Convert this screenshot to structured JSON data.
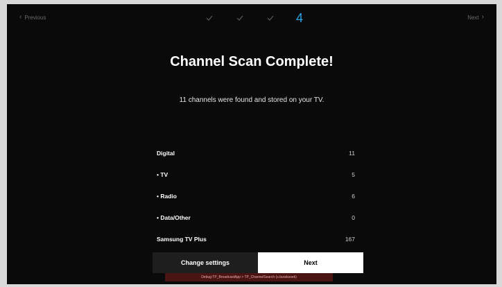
{
  "header": {
    "previous_label": "Previous",
    "next_label": "Next",
    "current_step": "4",
    "completed_steps": 3,
    "step_color": "#2aa6e6"
  },
  "main": {
    "title": "Channel Scan Complete!",
    "subtitle": "11 channels were found and stored on your TV.",
    "results": [
      {
        "label": "Digital",
        "value": "11"
      },
      {
        "label": "• TV",
        "value": "5"
      },
      {
        "label": "• Radio",
        "value": "6"
      },
      {
        "label": "• Data/Other",
        "value": "0"
      },
      {
        "label": "Samsung TV Plus",
        "value": "167"
      }
    ]
  },
  "buttons": {
    "change_settings_label": "Change settings",
    "next_label": "Next"
  },
  "debug": {
    "text": "Debug:TP_BroadcastApp > TP_ChannelSearch (s.buraksoek)"
  }
}
